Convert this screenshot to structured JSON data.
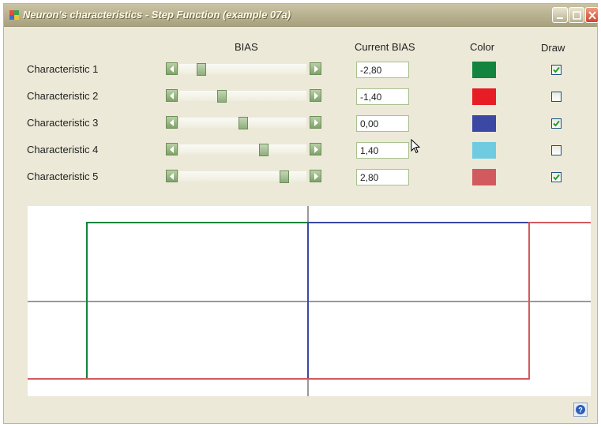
{
  "window": {
    "title": "Neuron's characteristics - Step Function (example 07a)"
  },
  "headers": {
    "bias": "BIAS",
    "current_bias": "Current BIAS",
    "color": "Color",
    "draw": "Draw"
  },
  "rows": [
    {
      "label": "Characteristic 1",
      "bias": "-2,80",
      "bias_value": -2.8,
      "color": "#12843d",
      "draw": true
    },
    {
      "label": "Characteristic 2",
      "bias": "-1,40",
      "bias_value": -1.4,
      "color": "#e81c24",
      "draw": false
    },
    {
      "label": "Characteristic 3",
      "bias": "0,00",
      "bias_value": 0.0,
      "color": "#3b48a4",
      "draw": true
    },
    {
      "label": "Characteristic 4",
      "bias": "1,40",
      "bias_value": 1.4,
      "color": "#6ecbe0",
      "draw": false
    },
    {
      "label": "Characteristic 5",
      "bias": "2,80",
      "bias_value": 2.8,
      "color": "#d25a5e",
      "draw": true
    }
  ],
  "slider": {
    "min": -4,
    "max": 4
  },
  "plot": {
    "axis_color": "#333333"
  },
  "icons": {
    "app": "app-icon",
    "minimize": "minimize-icon",
    "maximize": "maximize-icon",
    "close": "close-icon",
    "help": "help-icon",
    "cursor": "mouse-cursor-icon"
  }
}
